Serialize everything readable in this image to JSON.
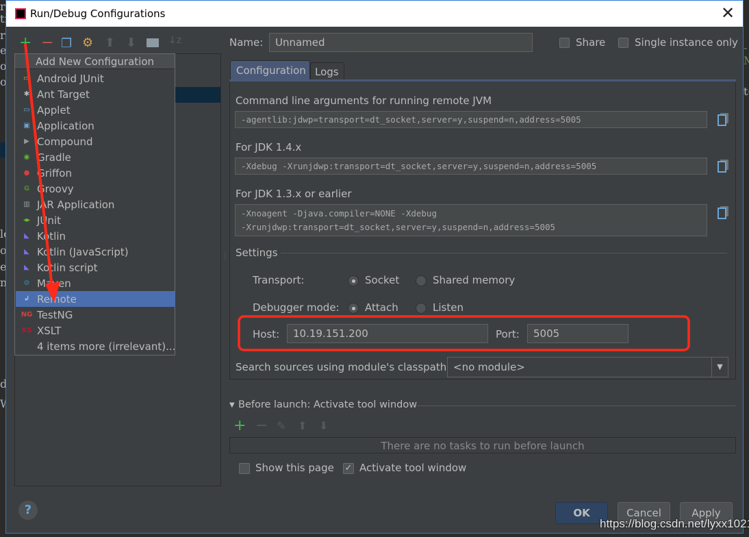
{
  "background": {
    "left_fragments": [
      "r",
      "tr",
      "rc",
      "e",
      "o",
      "o",
      "le",
      "ol",
      "e",
      "nt",
      "d",
      "W"
    ],
    "right_fragments": [
      "-M",
      "t("
    ]
  },
  "window": {
    "title": "Run/Debug Configurations",
    "close_icon": "close-icon"
  },
  "toolbar": {
    "icons": [
      "add-icon",
      "remove-icon",
      "copy-icon",
      "wrench-icon",
      "move-up-icon",
      "move-down-icon",
      "folder-icon",
      "sort-icon"
    ]
  },
  "popup": {
    "title": "Add New Configuration",
    "items": [
      {
        "label": "Android JUnit",
        "icon": "android-junit-icon"
      },
      {
        "label": "Ant Target",
        "icon": "ant-icon"
      },
      {
        "label": "Applet",
        "icon": "applet-icon"
      },
      {
        "label": "Application",
        "icon": "application-icon"
      },
      {
        "label": "Compound",
        "icon": "compound-icon"
      },
      {
        "label": "Gradle",
        "icon": "gradle-icon"
      },
      {
        "label": "Griffon",
        "icon": "griffon-icon"
      },
      {
        "label": "Groovy",
        "icon": "groovy-icon"
      },
      {
        "label": "JAR Application",
        "icon": "jar-icon"
      },
      {
        "label": "JUnit",
        "icon": "junit-icon"
      },
      {
        "label": "Kotlin",
        "icon": "kotlin-icon"
      },
      {
        "label": "Kotlin (JavaScript)",
        "icon": "kotlin-icon"
      },
      {
        "label": "Kotlin script",
        "icon": "kotlin-icon"
      },
      {
        "label": "Maven",
        "icon": "maven-gear-icon"
      },
      {
        "label": "Remote",
        "icon": "remote-icon",
        "selected": true
      },
      {
        "label": "TestNG",
        "icon": "testng-icon"
      },
      {
        "label": "XSLT",
        "icon": "xslt-icon"
      },
      {
        "label": "4 items more (irrelevant)...",
        "icon": ""
      }
    ]
  },
  "name": {
    "label": "Name:",
    "value": "Unnamed"
  },
  "share": {
    "label": "Share",
    "checked": false
  },
  "single_instance": {
    "label": "Single instance only",
    "checked": false
  },
  "tabs": [
    {
      "label": "Configuration",
      "active": true
    },
    {
      "label": "Logs",
      "active": false
    }
  ],
  "config": {
    "cmd_label": "Command line arguments for running remote JVM",
    "cmd_value": "-agentlib:jdwp=transport=dt_socket,server=y,suspend=n,address=5005",
    "jdk14_label": "For JDK 1.4.x",
    "jdk14_value": "-Xdebug -Xrunjdwp:transport=dt_socket,server=y,suspend=n,address=5005",
    "jdk13_label": "For JDK 1.3.x or earlier",
    "jdk13_line1": "-Xnoagent -Djava.compiler=NONE -Xdebug",
    "jdk13_line2": "-Xrunjdwp:transport=dt_socket,server=y,suspend=n,address=5005",
    "settings_label": "Settings",
    "transport_label": "Transport:",
    "transport_options": [
      {
        "label": "Socket",
        "selected": true
      },
      {
        "label": "Shared memory",
        "selected": false
      }
    ],
    "debugger_label": "Debugger mode:",
    "debugger_options": [
      {
        "label": "Attach",
        "selected": true
      },
      {
        "label": "Listen",
        "selected": false
      }
    ],
    "host_label": "Host:",
    "host_value": "10.19.151.200",
    "port_label": "Port:",
    "port_value": "5005",
    "module_label": "Search sources using module's classpath:",
    "module_value": "<no module>"
  },
  "before_launch": {
    "title": "Before launch: Activate tool window",
    "empty_text": "There are no tasks to run before launch",
    "show_page": {
      "label": "Show this page",
      "checked": false
    },
    "activate": {
      "label": "Activate tool window",
      "checked": true
    }
  },
  "buttons": {
    "ok": "OK",
    "cancel": "Cancel",
    "apply": "Apply"
  },
  "watermark": "https://blog.csdn.net/lyxx1021",
  "colors": {
    "accent": "#4b6eaf",
    "annotation": "#ff2a1a",
    "add": "#3fb950"
  }
}
